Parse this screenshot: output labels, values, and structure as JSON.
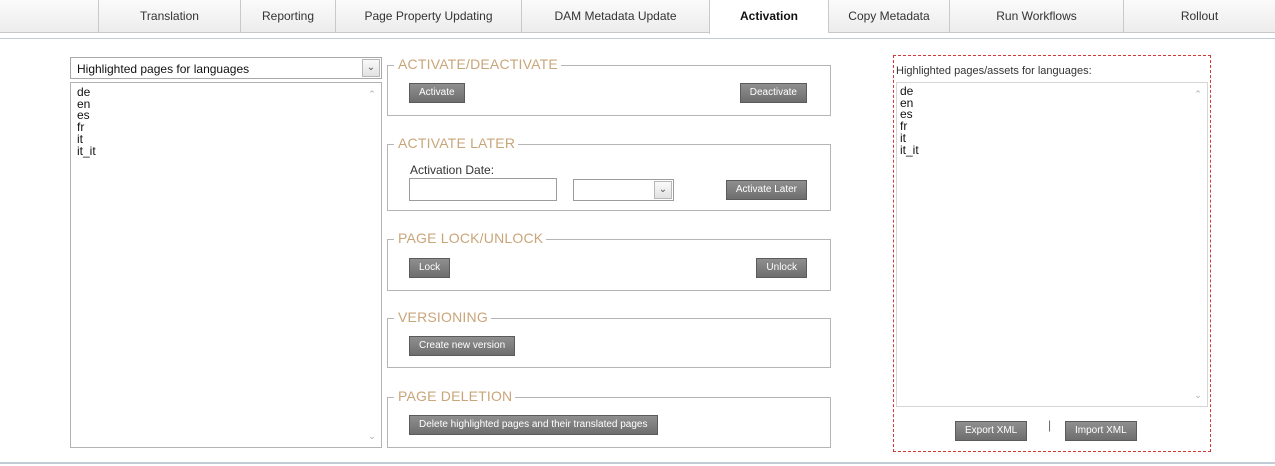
{
  "tabs": [
    {
      "label": "Translation",
      "active": false
    },
    {
      "label": "Reporting",
      "active": false
    },
    {
      "label": "Page Property Updating",
      "active": false
    },
    {
      "label": "DAM Metadata Update",
      "active": false
    },
    {
      "label": "Activation",
      "active": true
    },
    {
      "label": "Copy Metadata",
      "active": false
    },
    {
      "label": "Run Workflows",
      "active": false
    },
    {
      "label": "Rollout",
      "active": false
    }
  ],
  "left_panel": {
    "select_value": "Highlighted pages for languages",
    "languages": [
      "de",
      "en",
      "es",
      "fr",
      "it",
      "it_it"
    ]
  },
  "sections": {
    "activate_deactivate": {
      "legend": "ACTIVATE/DEACTIVATE",
      "activate_label": "Activate",
      "deactivate_label": "Deactivate"
    },
    "activate_later": {
      "legend": "ACTIVATE LATER",
      "date_label": "Activation Date:",
      "date_value": "",
      "time_value": "",
      "button_label": "Activate Later"
    },
    "lock_unlock": {
      "legend": "PAGE LOCK/UNLOCK",
      "lock_label": "Lock",
      "unlock_label": "Unlock"
    },
    "versioning": {
      "legend": "VERSIONING",
      "button_label": "Create new version"
    },
    "deletion": {
      "legend": "PAGE DELETION",
      "button_label": "Delete highlighted pages and their translated pages"
    }
  },
  "right_panel": {
    "title": "Highlighted pages/assets for languages:",
    "languages": [
      "de",
      "en",
      "es",
      "fr",
      "it",
      "it_it"
    ],
    "export_label": "Export XML",
    "separator": "|",
    "import_label": "Import XML"
  },
  "colors": {
    "legend": "#c9a57a",
    "button": "#7d7d7d",
    "right_border": "#d23a3a",
    "tab_border": "#c9c9c9"
  },
  "icons": {
    "dropdown": "chevron-down-icon",
    "scroll_up": "scroll-up-icon",
    "scroll_down": "scroll-down-icon"
  }
}
